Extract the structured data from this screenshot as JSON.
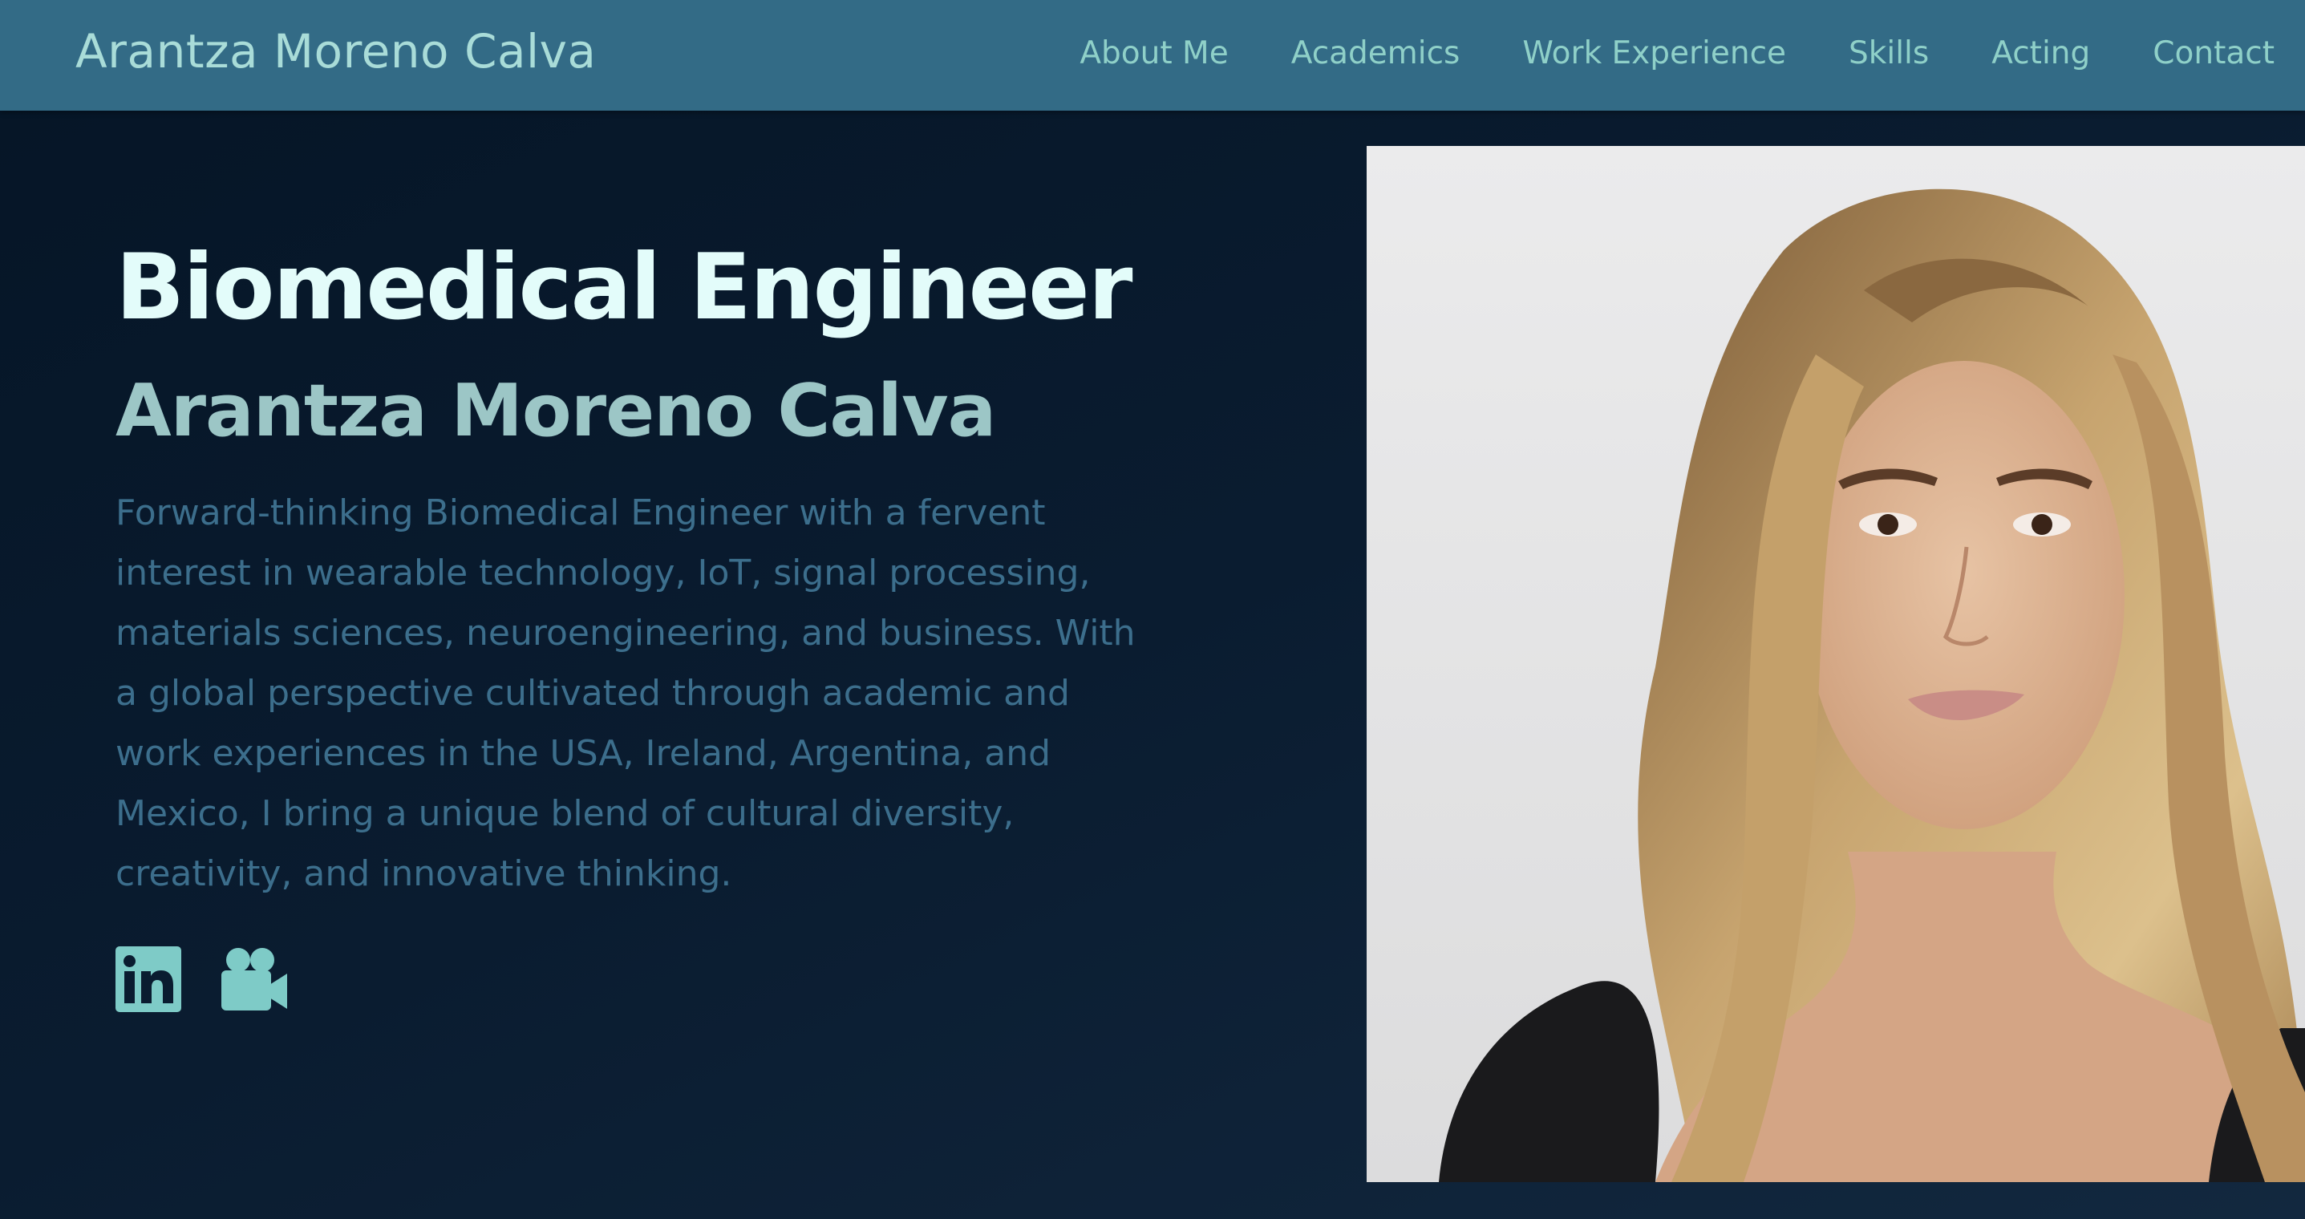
{
  "site": {
    "brand": "Arantza Moreno Calva"
  },
  "nav": {
    "items": [
      {
        "label": "About Me"
      },
      {
        "label": "Academics"
      },
      {
        "label": "Work Experience"
      },
      {
        "label": "Skills"
      },
      {
        "label": "Acting"
      },
      {
        "label": "Contact"
      }
    ]
  },
  "hero": {
    "headline": "Biomedical Engineer",
    "name": "Arantza Moreno Calva",
    "bio_lines": [
      "Forward-thinking Biomedical Engineer with a fervent",
      "interest in wearable technology, IoT, signal processing,",
      "materials sciences, neuroengineering, and business. With",
      "a global perspective cultivated through academic and",
      "work experiences in the USA, Ireland, Argentina, and",
      "Mexico, I bring a unique blend of cultural diversity,",
      "creativity, and innovative thinking."
    ]
  },
  "social": {
    "icons": [
      "linkedin-icon",
      "video-camera-icon"
    ]
  },
  "colors": {
    "navbar_bg": "#336b86",
    "page_bg": "#051526",
    "accent": "#7ecbc7",
    "headline": "#e3fcfa",
    "subhead": "#9cc6c6",
    "body_text": "#3c6e8c"
  }
}
